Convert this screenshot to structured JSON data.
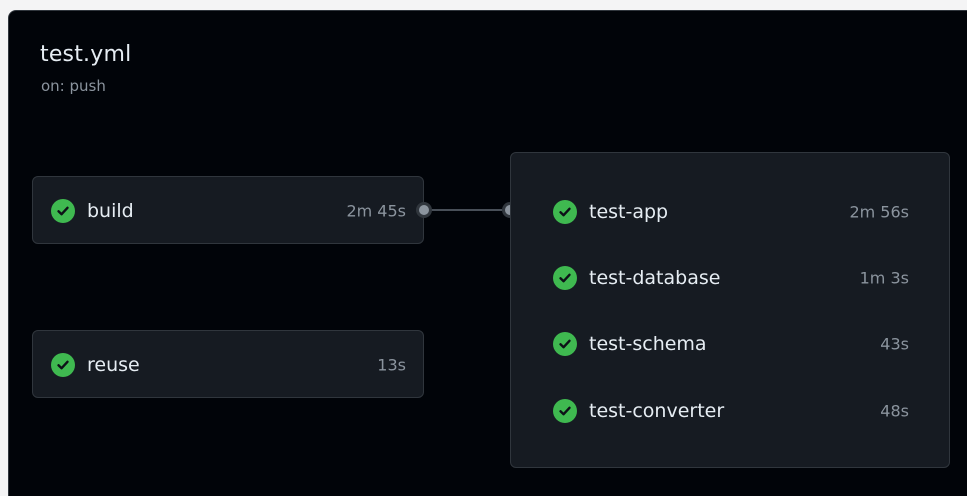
{
  "workflow": {
    "title": "test.yml",
    "trigger": "on: push"
  },
  "jobs": {
    "build": {
      "name": "build",
      "duration": "2m 45s",
      "status": "success"
    },
    "reuse": {
      "name": "reuse",
      "duration": "13s",
      "status": "success"
    }
  },
  "matrix": {
    "items": [
      {
        "name": "test-app",
        "duration": "2m 56s",
        "status": "success"
      },
      {
        "name": "test-database",
        "duration": "1m 3s",
        "status": "success"
      },
      {
        "name": "test-schema",
        "duration": "43s",
        "status": "success"
      },
      {
        "name": "test-converter",
        "duration": "48s",
        "status": "success"
      }
    ]
  },
  "icons": {
    "status_success": "check-circle-icon"
  },
  "colors": {
    "background": "#010409",
    "card": "#161b22",
    "border": "#30363d",
    "success": "#3fb950",
    "text": "#e6edf3",
    "muted": "#8b949e"
  }
}
